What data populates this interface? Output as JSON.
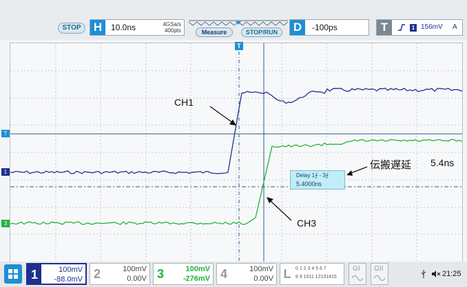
{
  "toolbar": {
    "stop_button": "STOP",
    "horizontal": {
      "badge": "H",
      "value": "10.0ns",
      "sample_rate": "4GSa/s",
      "points": "400pts"
    },
    "measure_button": "Measure",
    "stop_run_button": "STOP/RUN",
    "delay": {
      "badge": "D",
      "value": "-100ps"
    },
    "trigger": {
      "badge": "T",
      "channel": "1",
      "level": "156mV",
      "mode": "A"
    }
  },
  "annotations": {
    "ch1": "CH1",
    "ch3": "CH3",
    "propagation_label": "伝搬遅延",
    "propagation_value": "5.4ns"
  },
  "measurement": {
    "title": "Delay 1⨍ - 3⨍",
    "value": "5.4000ns"
  },
  "channels": [
    {
      "number": "1",
      "scale": "100mV",
      "offset": "-88.0mV",
      "color": "#1f2f8f"
    },
    {
      "number": "2",
      "scale": "100mV",
      "offset": "0.00V",
      "color": "#888888"
    },
    {
      "number": "3",
      "scale": "100mV",
      "offset": "-276mV",
      "color": "#22b33a"
    },
    {
      "number": "4",
      "scale": "100mV",
      "offset": "0.00V",
      "color": "#888888"
    }
  ],
  "logic": {
    "badge": "L",
    "row1": "0 1 2 3 4 5 6 7",
    "row2": "8 9 1011 12131415"
  },
  "gen": [
    "GI",
    "GII"
  ],
  "clock": "21:25",
  "markers": {
    "trigger_marker": "T",
    "ch1_marker": "1",
    "ch3_marker": "3"
  },
  "colors": {
    "ch1": "#1f2f8f",
    "ch3": "#22b33a",
    "cursor": "#2a5d8c",
    "teal": "#1aa0b8"
  }
}
